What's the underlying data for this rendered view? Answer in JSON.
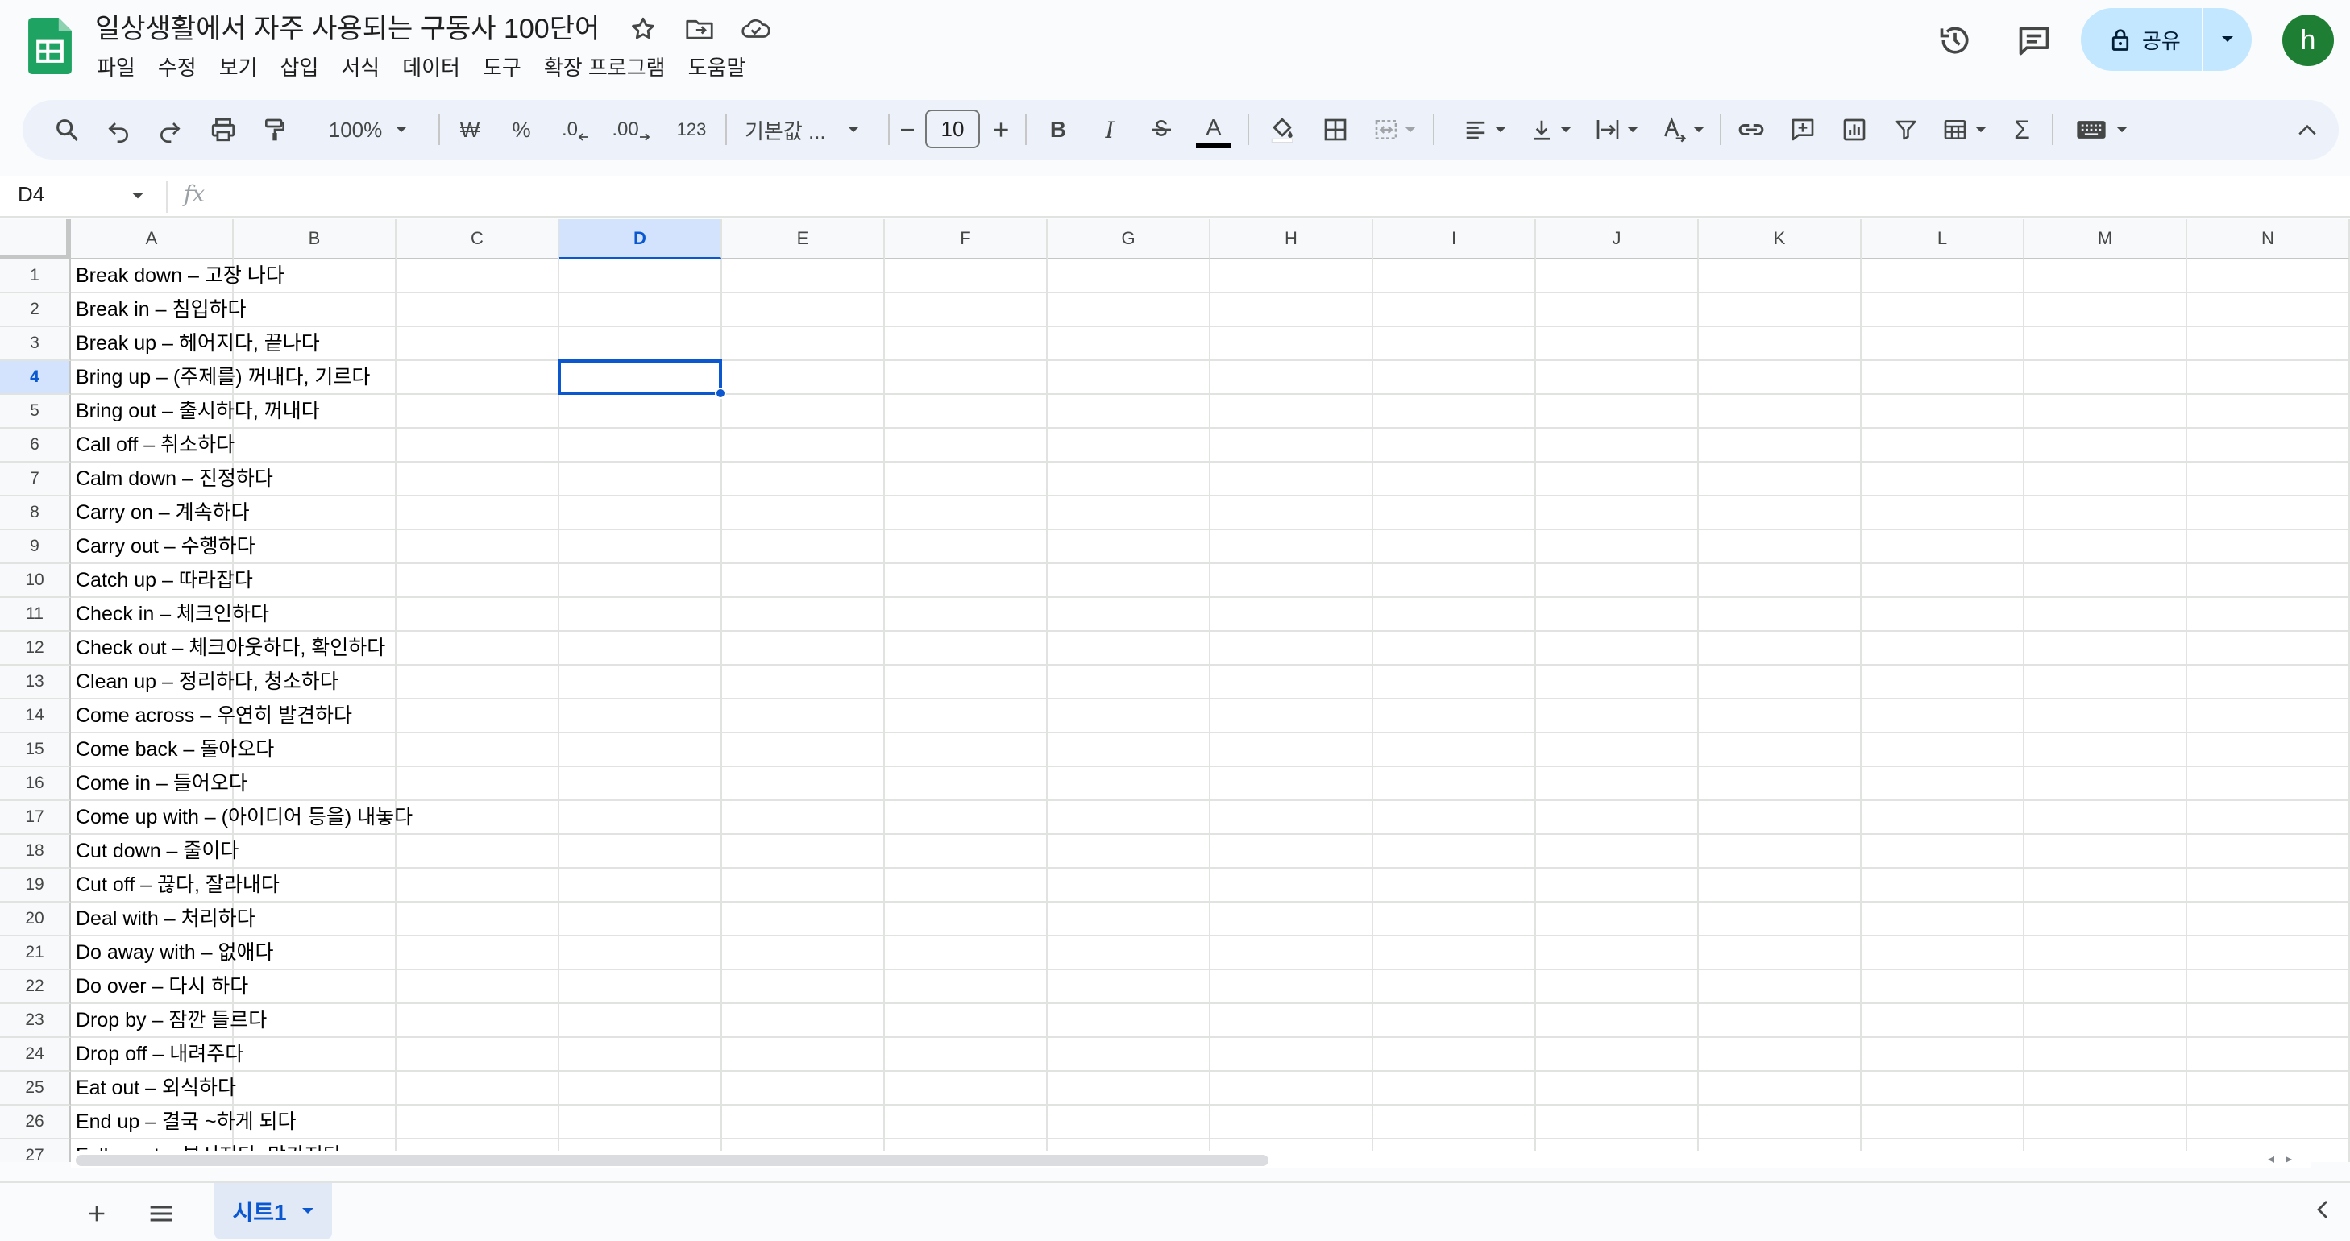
{
  "document": {
    "title": "일상생활에서 자주 사용되는 구동사 100단어"
  },
  "menu": [
    "파일",
    "수정",
    "보기",
    "삽입",
    "서식",
    "데이터",
    "도구",
    "확장 프로그램",
    "도움말"
  ],
  "header": {
    "share_label": "공유",
    "avatar_initial": "h"
  },
  "toolbar": {
    "zoom": "100%",
    "currency": "₩",
    "percent": "%",
    "decrease_decimal": ".0",
    "increase_decimal": ".00",
    "number_format": "123",
    "font": "기본값 ...",
    "font_size": "10",
    "bold": "B",
    "italic": "I",
    "text_color_letter": "A",
    "sum": "Σ"
  },
  "formula_bar": {
    "name_box": "D4",
    "fx": "fx"
  },
  "columns": [
    "A",
    "B",
    "C",
    "D",
    "E",
    "F",
    "G",
    "H",
    "I",
    "J",
    "K",
    "L",
    "M",
    "N"
  ],
  "selected_cell": {
    "col": "D",
    "row": 4
  },
  "rows": [
    {
      "n": "1",
      "a": "Break down – 고장 나다"
    },
    {
      "n": "2",
      "a": "Break in – 침입하다"
    },
    {
      "n": "3",
      "a": "Break up – 헤어지다, 끝나다"
    },
    {
      "n": "4",
      "a": "Bring up – (주제를) 꺼내다, 기르다"
    },
    {
      "n": "5",
      "a": "Bring out – 출시하다, 꺼내다"
    },
    {
      "n": "6",
      "a": "Call off – 취소하다"
    },
    {
      "n": "7",
      "a": "Calm down – 진정하다"
    },
    {
      "n": "8",
      "a": "Carry on – 계속하다"
    },
    {
      "n": "9",
      "a": "Carry out – 수행하다"
    },
    {
      "n": "10",
      "a": "Catch up – 따라잡다"
    },
    {
      "n": "11",
      "a": "Check in – 체크인하다"
    },
    {
      "n": "12",
      "a": "Check out – 체크아웃하다, 확인하다"
    },
    {
      "n": "13",
      "a": "Clean up – 정리하다, 청소하다"
    },
    {
      "n": "14",
      "a": "Come across – 우연히 발견하다"
    },
    {
      "n": "15",
      "a": "Come back – 돌아오다"
    },
    {
      "n": "16",
      "a": "Come in – 들어오다"
    },
    {
      "n": "17",
      "a": "Come up with – (아이디어 등을) 내놓다"
    },
    {
      "n": "18",
      "a": "Cut down – 줄이다"
    },
    {
      "n": "19",
      "a": "Cut off – 끊다, 잘라내다"
    },
    {
      "n": "20",
      "a": "Deal with – 처리하다"
    },
    {
      "n": "21",
      "a": "Do away with – 없애다"
    },
    {
      "n": "22",
      "a": "Do over – 다시 하다"
    },
    {
      "n": "23",
      "a": "Drop by – 잠깐 들르다"
    },
    {
      "n": "24",
      "a": "Drop off – 내려주다"
    },
    {
      "n": "25",
      "a": "Eat out – 외식하다"
    },
    {
      "n": "26",
      "a": "End up – 결국 ~하게 되다"
    },
    {
      "n": "27",
      "a": "Fall apart – 부서지다, 망가지다"
    }
  ],
  "sheet_tabs": [
    {
      "label": "시트1",
      "active": true
    }
  ],
  "colors": {
    "accent": "#0b57d0",
    "share_bg": "#c2e7ff",
    "toolbar_bg": "#edf2fa",
    "sheets_green": "#188038",
    "avatar": "#1e7e34"
  }
}
